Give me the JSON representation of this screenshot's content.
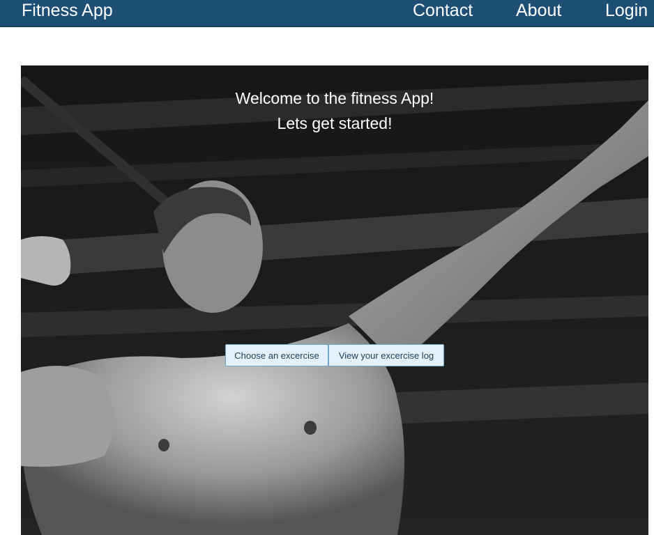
{
  "navbar": {
    "brand": "Fitness App",
    "links": [
      "Contact",
      "About",
      "Login"
    ],
    "background_color": "#1c4f73"
  },
  "hero": {
    "title_line1": "Welcome to the fitness App!",
    "title_line2": "Lets get started!",
    "buttons": [
      "Choose an excercise",
      "View your excercise log"
    ],
    "button_color": "#e4f1fa"
  }
}
